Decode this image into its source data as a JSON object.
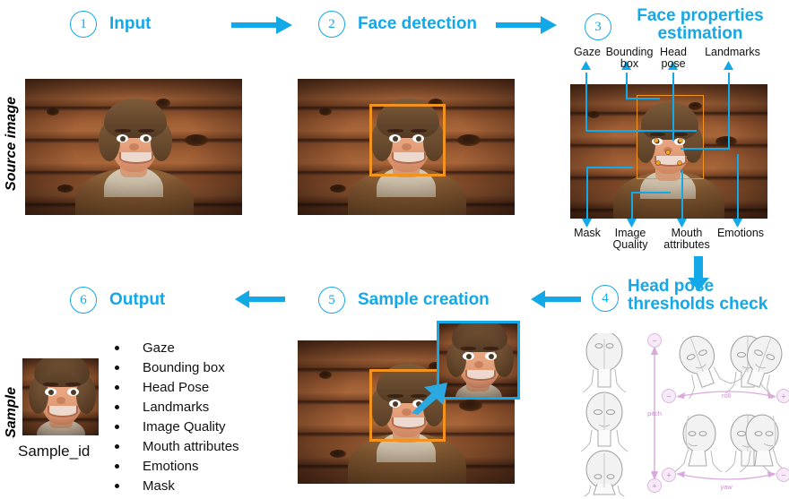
{
  "colors": {
    "accent_cyan": "#13a8e8",
    "bbox_orange": "#f2921f",
    "landmark_orange": "#f5a623",
    "headpose_purple": "#c98fd0",
    "text_black": "#111111"
  },
  "row_labels": {
    "source_image": "Source image",
    "sample": "Sample"
  },
  "steps": [
    {
      "number": "1",
      "title": "Input"
    },
    {
      "number": "2",
      "title": "Face detection"
    },
    {
      "number": "3",
      "title": "Face properties\nestimation"
    },
    {
      "number": "4",
      "title": "Head pose\nthresholds check"
    },
    {
      "number": "5",
      "title": "Sample creation"
    },
    {
      "number": "6",
      "title": "Output"
    }
  ],
  "arrows": {
    "step1_to_step2": "arrow-right",
    "step2_to_step3": "arrow-right",
    "step3_to_step4": "arrow-down",
    "step4_to_step5": "arrow-left",
    "step5_to_step6": "arrow-left",
    "crop_extract": "arrow-up-right"
  },
  "face_properties": {
    "top_labels": [
      "Gaze",
      "Bounding\nbox",
      "Head\npose",
      "Landmarks"
    ],
    "bottom_labels": [
      "Mask",
      "Image\nQuality",
      "Mouth\nattributes",
      "Emotions"
    ]
  },
  "head_pose": {
    "axes": [
      "pitch",
      "roll",
      "yaw"
    ],
    "signs": [
      "−",
      "+"
    ],
    "pitch_top_sign": "−",
    "pitch_bottom_sign": "+",
    "roll_left_sign": "−",
    "roll_right_sign": "+",
    "yaw_left_sign": "+",
    "yaw_right_sign": "−"
  },
  "output": {
    "sample_id": "Sample_id",
    "properties": [
      "Gaze",
      "Bounding box",
      "Head Pose",
      "Landmarks",
      "Image Quality",
      "Mouth attributes",
      "Emotions",
      "Mask"
    ]
  }
}
